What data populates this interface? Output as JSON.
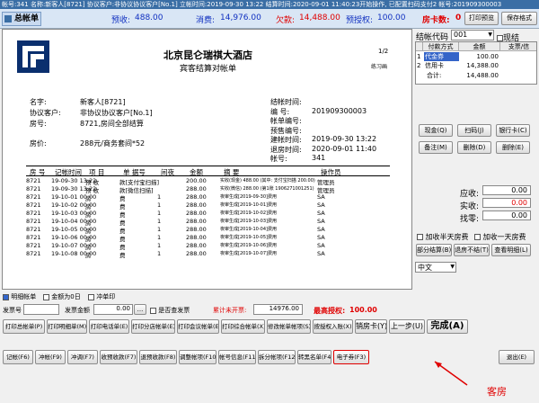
{
  "titlebar": "帐号:341 名称:新客人[8721] 协议客户:非协议协议客户[No.1] 立帐时间:2019-09-30 13:22 结算时间:2020-09-01 11:40:23开始操作, 已配置扫码支付2 帐号:201909300003",
  "tab": {
    "label": "总帐单"
  },
  "topbar": {
    "prepaid_label": "预收:",
    "prepaid_value": "488.00",
    "consume_label": "消费:",
    "consume_value": "14,976.00",
    "owe_label": "欠款:",
    "owe_value": "14,488.00",
    "auth_label": "预授权:",
    "auth_value": "100.00",
    "rooms_label": "房卡数:",
    "rooms_value": "0",
    "print_preview": "打印预览",
    "save_format": "保存格式"
  },
  "doc": {
    "page": "1/2",
    "hotel": "北京昆仑瑞祺大酒店",
    "title": "宾客结算对帐单",
    "tag": "练习画",
    "left": [
      {
        "k": "名字:",
        "v": "新客人[8721]"
      },
      {
        "k": "协议客户:",
        "v": "非协议协议客户[No.1]"
      },
      {
        "k": "房号:",
        "v": "8721,房间全部结算"
      },
      {
        "k": "房价:",
        "v": "288元/商务套间*52"
      }
    ],
    "right": [
      {
        "k": "结帐时间:",
        "v": ""
      },
      {
        "k": "编   号:",
        "v": "201909300003"
      },
      {
        "k": "帐单编号:",
        "v": ""
      },
      {
        "k": "预售编号:",
        "v": ""
      },
      {
        "k": "建帐时间:",
        "v": "2019-09-30 13:22"
      },
      {
        "k": "退房时间:",
        "v": "2020-09-01 11:40"
      },
      {
        "k": "帐号:",
        "v": "341"
      }
    ],
    "headers": [
      "房  号",
      "记帐时间",
      "项  目",
      "单  据号",
      "间夜",
      "金额",
      "摘  要",
      "操作员"
    ],
    "rows": [
      [
        "8721",
        "19-09-30 13:22",
        "预 收",
        "款[支付宝扫描]",
        "",
        "200.00",
        "实收(现金) 488.00 (其中: 支付宝扫描 200.00)",
        "管理员"
      ],
      [
        "8721",
        "19-09-30 13:22",
        "预 收",
        "款[微信扫描]",
        "",
        "288.00",
        "实收(微信) 288.00 (第1账 1906271001251)",
        "管理员"
      ],
      [
        "8721",
        "19-10-01 00:00",
        "房",
        "费",
        "1",
        "288.00",
        "夜审生成[2019-09-30]费用",
        "SA"
      ],
      [
        "8721",
        "19-10-02 00:00",
        "房",
        "费",
        "1",
        "288.00",
        "夜审生成[2019-10-01]费用",
        "SA"
      ],
      [
        "8721",
        "19-10-03 00:00",
        "房",
        "费",
        "1",
        "288.00",
        "夜审生成[2019-10-02]费用",
        "SA"
      ],
      [
        "8721",
        "19-10-04 00:00",
        "房",
        "费",
        "1",
        "288.00",
        "夜审生成[2019-10-03]费用",
        "SA"
      ],
      [
        "8721",
        "19-10-05 00:00",
        "房",
        "费",
        "1",
        "288.00",
        "夜审生成[2019-10-04]费用",
        "SA"
      ],
      [
        "8721",
        "19-10-06 00:00",
        "房",
        "费",
        "1",
        "288.00",
        "夜审生成[2019-10-05]费用",
        "SA"
      ],
      [
        "8721",
        "19-10-07 00:00",
        "房",
        "费",
        "1",
        "288.00",
        "夜审生成[2019-10-06]费用",
        "SA"
      ],
      [
        "8721",
        "19-10-08 00:00",
        "房",
        "费",
        "1",
        "288.00",
        "夜审生成[2019-10-07]费用",
        "SA"
      ]
    ]
  },
  "pay": {
    "code_label": "结帐代码",
    "code_value": "001",
    "cash_label": "现结",
    "col_method": "付款方式",
    "col_amount": "金额",
    "col_auth": "支票/信",
    "rows": [
      [
        "1",
        "代金券",
        "100.00"
      ],
      [
        "2",
        "信用卡",
        "14,388.00"
      ]
    ],
    "total_label": "合计:",
    "total_value": "14,488.00",
    "b1": [
      "现金(Q)",
      "扫码(J)",
      "银行卡(C)"
    ],
    "b2": [
      "备注(M)",
      "删除(D)",
      "删除(E)"
    ],
    "recv_label": "应收:",
    "recv_value": "0.00",
    "paid_label": "实收:",
    "paid_value": "0.00",
    "change_label": "找零:",
    "change_value": "0.00",
    "half_day": "加收半天房费",
    "full_day": "加收一天房费",
    "split": "部分结算(B)",
    "refund": "退房不结(T)",
    "detail": "查看明细(L)",
    "lang": "中文"
  },
  "bar1": {
    "show_detail": "明细帐单",
    "all_zero": "金额为0日",
    "reverse": "冲单印",
    "invoice_no": "发票号",
    "invoice_amt": "发票金额",
    "invoice_val": "0.00",
    "ellipsis": "...",
    "open_invoice": "是否查发票",
    "unopened_label": "累计未开票:",
    "unopened_value": "14976.00",
    "max_auth_label": "最高授权:",
    "max_auth_value": "100.00"
  },
  "bar2": [
    "打印总帐单(P)",
    "打印明细单(M)",
    "打印电话单(E)",
    "打印分店帐单(E)",
    "打印会议帐单(E)",
    "打印综合帐单(X)",
    "修改帐单帐项(S)",
    "按授权入账(X)",
    "销房卡(Y)",
    "上一步(U)",
    "完成(A)"
  ],
  "bar3": [
    "记帐(F6)",
    "冲帐(F9)",
    "冲调(F7)",
    "收预收款(F7)",
    "退预收款(F8)",
    "调整帐项(F10)",
    "帐号信息(F11)",
    "拆分帐项(F12)",
    "转黑名单(F4)",
    "电子券(F3)",
    "退出(E)"
  ],
  "annotation": "客房"
}
